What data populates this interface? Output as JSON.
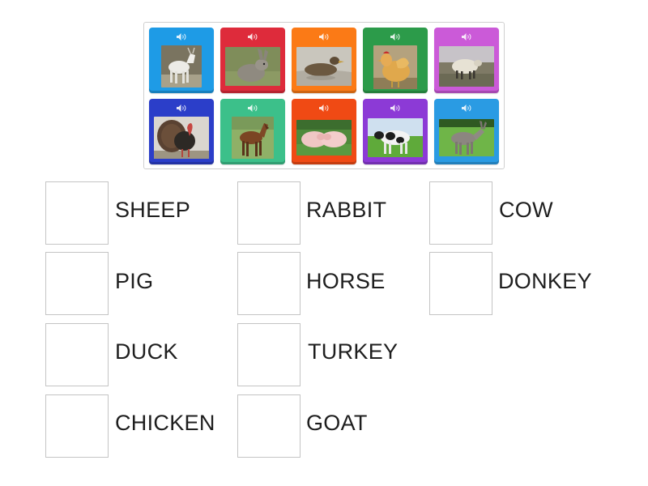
{
  "tiles": [
    {
      "animal": "goat-photo",
      "color": "#1e9be6"
    },
    {
      "animal": "rabbit-photo",
      "color": "#de2b3b"
    },
    {
      "animal": "duck-photo",
      "color": "#fb7a16"
    },
    {
      "animal": "chicken-photo",
      "color": "#2c9b4a"
    },
    {
      "animal": "sheep-photo",
      "color": "#cb5ad8"
    },
    {
      "animal": "turkey-photo",
      "color": "#2b3ec9"
    },
    {
      "animal": "horse-photo",
      "color": "#3cc08a"
    },
    {
      "animal": "pig-photo",
      "color": "#f04a14"
    },
    {
      "animal": "cow-photo",
      "color": "#8c3ad6"
    },
    {
      "animal": "donkey-photo",
      "color": "#2a9be3"
    }
  ],
  "labels": {
    "sheep": "SHEEP",
    "rabbit": "RABBIT",
    "cow": "COW",
    "pig": "PIG",
    "horse": "HORSE",
    "donkey": "DONKEY",
    "duck": "DUCK",
    "turkey": "TURKEY",
    "chicken": "CHICKEN",
    "goat": "GOAT"
  }
}
